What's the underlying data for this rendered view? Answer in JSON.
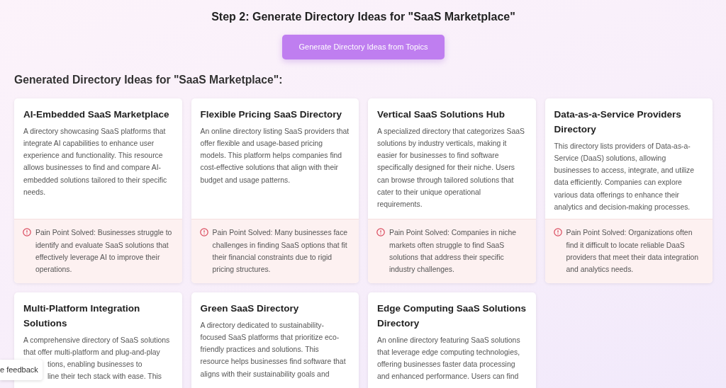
{
  "step_title": "Step 2: Generate Directory Ideas for \"SaaS Marketplace\"",
  "generate_button": "Generate Directory Ideas from Topics",
  "results_heading": "Generated Directory Ideas for \"SaaS Marketplace\":",
  "ideas": [
    {
      "title": "AI-Embedded SaaS Marketplace",
      "description": "A directory showcasing SaaS platforms that integrate AI capabilities to enhance user experience and functionality. This resource allows businesses to find and compare AI-embedded solutions tailored to their specific needs.",
      "pain_point": "Pain Point Solved: Businesses struggle to identify and evaluate SaaS solutions that effectively leverage AI to improve their operations."
    },
    {
      "title": "Flexible Pricing SaaS Directory",
      "description": "An online directory listing SaaS providers that offer flexible and usage-based pricing models. This platform helps companies find cost-effective solutions that align with their budget and usage patterns.",
      "pain_point": "Pain Point Solved: Many businesses face challenges in finding SaaS options that fit their financial constraints due to rigid pricing structures."
    },
    {
      "title": "Vertical SaaS Solutions Hub",
      "description": "A specialized directory that categorizes SaaS solutions by industry verticals, making it easier for businesses to find software specifically designed for their niche. Users can browse through tailored solutions that cater to their unique operational requirements.",
      "pain_point": "Pain Point Solved: Companies in niche markets often struggle to find SaaS solutions that address their specific industry challenges."
    },
    {
      "title": "Data-as-a-Service Providers Directory",
      "description": "This directory lists providers of Data-as-a-Service (DaaS) solutions, allowing businesses to access, integrate, and utilize data efficiently. Companies can explore various data offerings to enhance their analytics and decision-making processes.",
      "pain_point": "Pain Point Solved: Organizations often find it difficult to locate reliable DaaS providers that meet their data integration and analytics needs."
    },
    {
      "title": "Multi-Platform Integration Solutions",
      "description_lines": [
        {
          "text": "A comprehensive directory of SaaS solutions",
          "covered": false
        },
        {
          "text": "that offer multi-platform and plug-and-play",
          "covered": false
        },
        {
          "text": "tions, enabling businesses to",
          "covered": true
        },
        {
          "text": "line their tech stack with ease. This",
          "covered": true
        }
      ]
    },
    {
      "title": "Green SaaS Directory",
      "description": "A directory dedicated to sustainability-focused SaaS platforms that prioritize eco-friendly practices and solutions. This resource helps businesses find software that aligns with their sustainability goals and"
    },
    {
      "title": "Edge Computing SaaS Solutions Directory",
      "description": "An online directory featuring SaaS solutions that leverage edge computing technologies, offering businesses faster data processing and enhanced performance. Users can find"
    }
  ],
  "feedback_tab": "e feedback"
}
